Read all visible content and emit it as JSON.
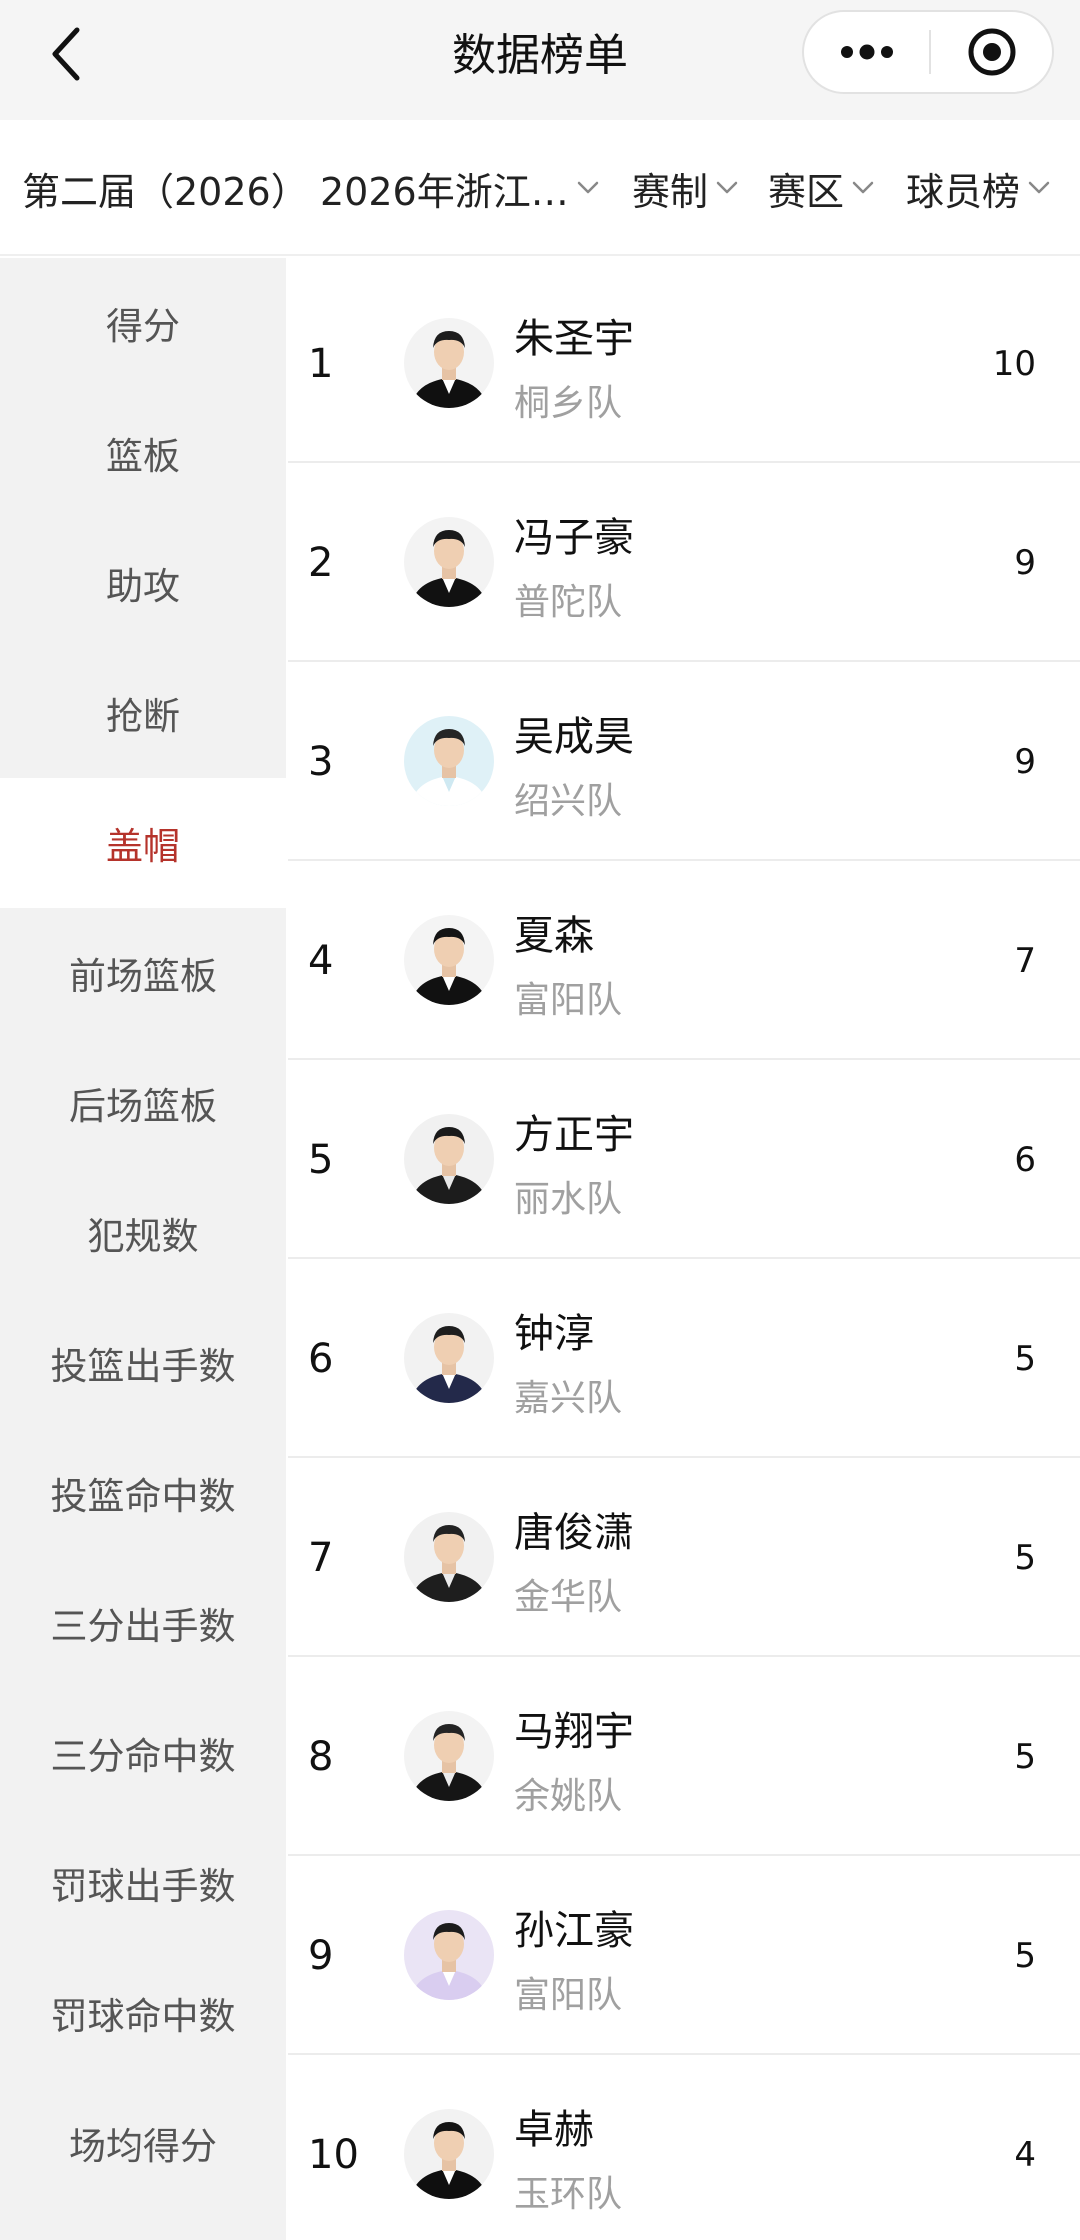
{
  "nav": {
    "title": "数据榜单",
    "back_icon": "chevron-left-icon",
    "more_icon": "more-dots-icon",
    "close_icon": "target-close-icon"
  },
  "filters": [
    {
      "label": "第二届（2026）",
      "has_chevron": false
    },
    {
      "label": "2026年浙江…",
      "has_chevron": true
    },
    {
      "label": "赛制",
      "has_chevron": true
    },
    {
      "label": "赛区",
      "has_chevron": true
    },
    {
      "label": "球员榜",
      "has_chevron": true
    }
  ],
  "sidebar": {
    "active_index": 4,
    "items": [
      "得分",
      "篮板",
      "助攻",
      "抢断",
      "盖帽",
      "前场篮板",
      "后场篮板",
      "犯规数",
      "投篮出手数",
      "投篮命中数",
      "三分出手数",
      "三分命中数",
      "罚球出手数",
      "罚球命中数",
      "场均得分"
    ]
  },
  "players": [
    {
      "rank": "1",
      "name": "朱圣宇",
      "team": "桐乡队",
      "value": "10"
    },
    {
      "rank": "2",
      "name": "冯子豪",
      "team": "普陀队",
      "value": "9"
    },
    {
      "rank": "3",
      "name": "吴成昊",
      "team": "绍兴队",
      "value": "9"
    },
    {
      "rank": "4",
      "name": "夏森",
      "team": "富阳队",
      "value": "7"
    },
    {
      "rank": "5",
      "name": "方正宇",
      "team": "丽水队",
      "value": "6"
    },
    {
      "rank": "6",
      "name": "钟淳",
      "team": "嘉兴队",
      "value": "5"
    },
    {
      "rank": "7",
      "name": "唐俊潇",
      "team": "金华队",
      "value": "5"
    },
    {
      "rank": "8",
      "name": "马翔宇",
      "team": "余姚队",
      "value": "5"
    },
    {
      "rank": "9",
      "name": "孙江豪",
      "team": "富阳队",
      "value": "5"
    },
    {
      "rank": "10",
      "name": "卓赫",
      "team": "玉环队",
      "value": "4"
    }
  ],
  "colors": {
    "accent": "#b5332b",
    "nav_bg": "#f5f5f5",
    "sidebar_bg": "#f2f2f2",
    "team_text": "#a0a0a0"
  }
}
